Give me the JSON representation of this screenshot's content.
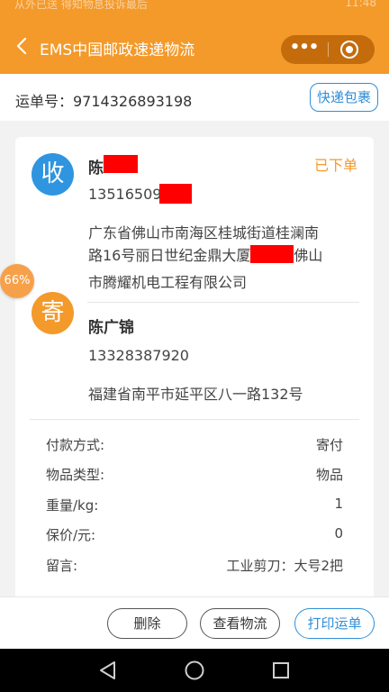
{
  "status_bar": {
    "left_text": "从外已送 得知物息投诉最后",
    "right_text": "11:48"
  },
  "nav": {
    "title": "EMS中国邮政速递物流",
    "more_glyph": "•••"
  },
  "waybill": {
    "label_text": "运单号：9714326893198",
    "package_button": "快递包裹"
  },
  "recipient": {
    "badge": "收",
    "name": "陈",
    "phone": "13516509",
    "address_line1": "广东省佛山市南海区桂城街道桂澜南",
    "address_line2_a": "路16号丽日世纪金鼎大厦",
    "address_line2_b": "佛山",
    "address_line3": "市腾耀机电工程有限公司",
    "status": "已下单"
  },
  "sender": {
    "badge": "寄",
    "name": "陈广锦",
    "phone": "13328387920",
    "address": "福建省南平市延平区八一路132号"
  },
  "details": [
    {
      "label": "付款方式:",
      "value": "寄付"
    },
    {
      "label": "物品类型:",
      "value": "物品"
    },
    {
      "label": "重量/kg:",
      "value": "1"
    },
    {
      "label": "保价/元:",
      "value": "0"
    },
    {
      "label": "留言:",
      "value": "工业剪刀：大号2把"
    }
  ],
  "floating_badge": "66%",
  "actions": {
    "delete": "删除",
    "view_logistics": "查看物流",
    "print_waybill": "打印运单"
  },
  "colors": {
    "primary_orange": "#f39a2b",
    "accent_blue": "#2f8ed8",
    "redaction": "#ff0000"
  },
  "icons": {
    "back": "chevron-left-icon",
    "more": "more-dots-icon",
    "close": "target-close-icon",
    "sys_back": "triangle-back-icon",
    "sys_home": "circle-home-icon",
    "sys_recent": "square-recent-icon"
  }
}
